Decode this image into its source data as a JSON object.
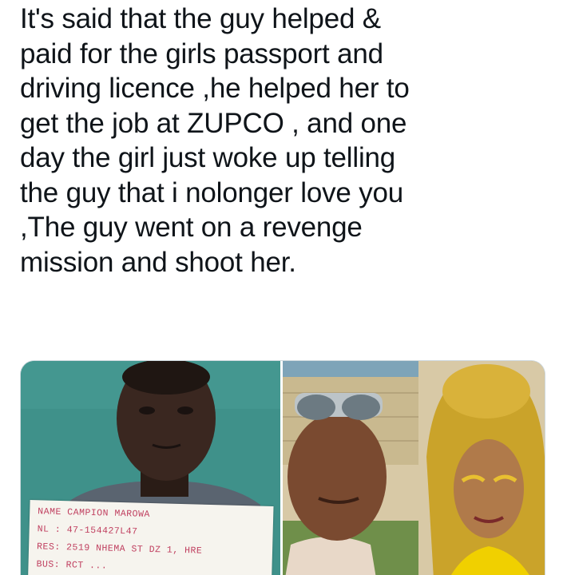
{
  "tweet": {
    "text_lines": [
      "It's said that the guy helped &",
      "paid for the girls passport and",
      "driving licence ,he helped her to",
      "get the job at ZUPCO , and one",
      "day the girl just woke up telling",
      "the guy that i nolonger love you",
      ",The guy went on a revenge",
      "mission and shoot her."
    ]
  },
  "media": {
    "photo_left": {
      "placard_lines": [
        "NAME CAMPION MAROWA",
        "NL : 47-154427L47",
        "RES: 2519 NHEMA ST DZ 1, HRE",
        "BUS: RCT ..."
      ]
    }
  },
  "colors": {
    "text": "#0f1419",
    "media_border": "#cfd9de",
    "placard_ink": "#c04060"
  }
}
